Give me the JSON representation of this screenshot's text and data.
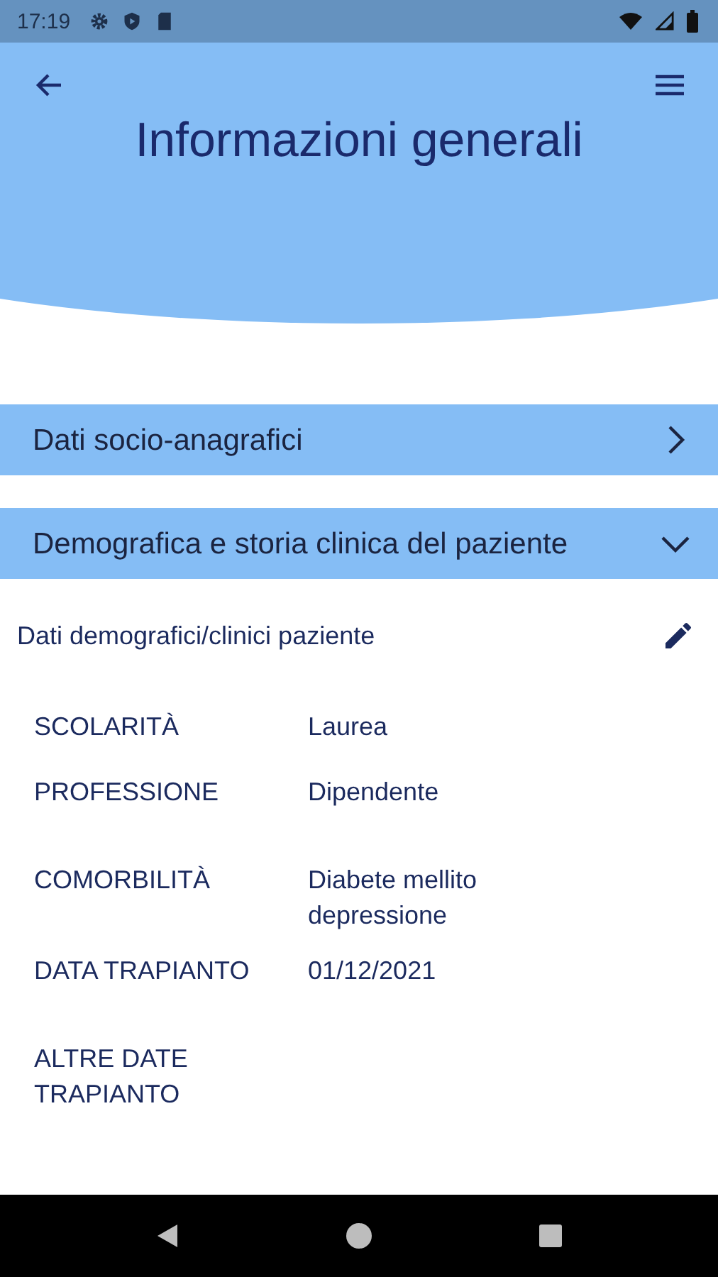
{
  "status_bar": {
    "time": "17:19"
  },
  "header": {
    "title": "Informazioni generali"
  },
  "sections": [
    {
      "title": "Dati socio-anagrafici",
      "expanded": false
    },
    {
      "title": "Demografica e storia clinica del paziente",
      "expanded": true,
      "subtitle": "Dati demografici/clinici paziente",
      "rows": [
        {
          "label": "SCOLARITÀ",
          "value": "Laurea"
        },
        {
          "label": "PROFESSIONE",
          "value": "Dipendente"
        },
        {
          "label": "COMORBILITÀ",
          "value": "Diabete mellito\ndepressione"
        },
        {
          "label": "DATA TRAPIANTO",
          "value": "01/12/2021"
        },
        {
          "label": "ALTRE DATE\nTRAPIANTO"
        }
      ]
    }
  ]
}
